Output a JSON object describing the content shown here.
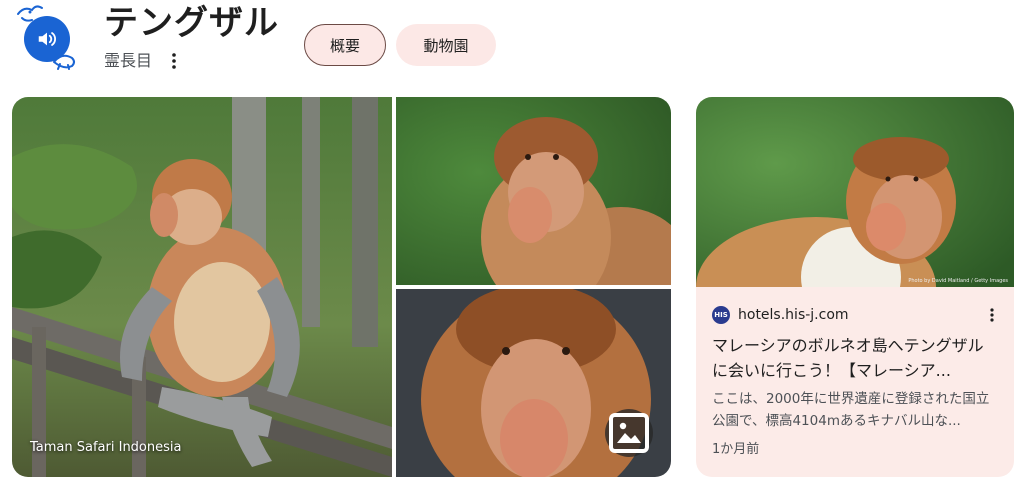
{
  "header": {
    "title": "テングザル",
    "subtitle": "霊長目",
    "speaker_icon": "volume-icon",
    "doodle_icon": "animal-doodle-icon"
  },
  "chips": [
    {
      "label": "概要",
      "selected": true
    },
    {
      "label": "動物園",
      "selected": false
    }
  ],
  "gallery": {
    "main_caption": "Taman Safari Indonesia",
    "lens_icon": "image-search-icon"
  },
  "card": {
    "source_badge": "HIS",
    "source": "hotels.his-j.com",
    "title": "マレーシアのボルネオ島へテングザルに会いに行こう！【マレーシア...",
    "description": "ここは、2000年に世界遺産に登録された国立公園で、標高4104mあるキナバル山な...",
    "time": "1か月前",
    "credit": "Photo by David Maitland / Getty Images"
  },
  "colors": {
    "accent_blue": "#1a64d3",
    "chip_bg": "#fce8e6",
    "card_bg": "#fcebe8"
  }
}
